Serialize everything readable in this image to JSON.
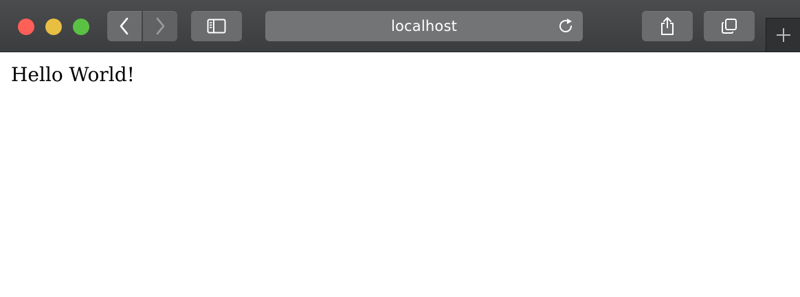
{
  "window": {
    "traffic_lights": {
      "close_color": "#fe5f57",
      "minimize_color": "#e8bf43",
      "zoom_color": "#5ac145"
    }
  },
  "toolbar": {
    "address": "localhost",
    "icons": {
      "back": "chevron-left-icon",
      "forward": "chevron-right-icon",
      "sidebar": "sidebar-icon",
      "reload": "reload-icon",
      "share": "share-icon",
      "tabs": "tab-overview-icon",
      "new_tab": "plus-icon"
    }
  },
  "page": {
    "text": "Hello World!"
  }
}
